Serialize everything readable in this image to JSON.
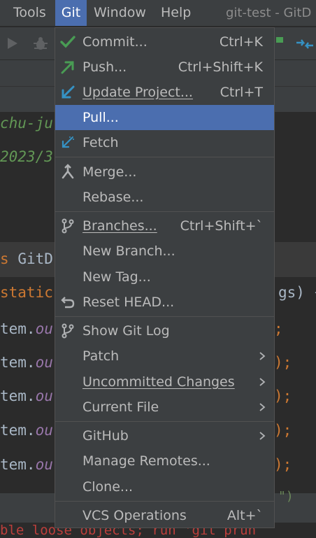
{
  "menubar": {
    "items": [
      {
        "label": "Tools",
        "mnemonic": "T"
      },
      {
        "label": "Git",
        "mnemonic": "G"
      },
      {
        "label": "Window",
        "mnemonic": "W"
      },
      {
        "label": "Help",
        "mnemonic": "H"
      }
    ],
    "window_title": "git-test - GitD"
  },
  "editor": {
    "line_author": "chu-ju",
    "line_date": "2023/3",
    "class_kw": "s",
    "class_name": "GitD",
    "static_kw": "static",
    "args_tail": "gs) {",
    "sys_prefix": "tem.",
    "sys_method": "ou",
    "tails": [
      ";",
      ");",
      ");",
      ");",
      ");"
    ],
    "bottom_tail": "\")",
    "red_text": "ble loose objects; run 'git prun"
  },
  "menu": {
    "items": [
      {
        "label": "Commit...",
        "shortcut": "Ctrl+K",
        "icon": "checkmark-icon"
      },
      {
        "label": "Push...",
        "shortcut": "Ctrl+Shift+K",
        "icon": "push-arrow-icon"
      },
      {
        "label": "Update Project...",
        "shortcut": "Ctrl+T",
        "icon": "update-arrow-icon"
      },
      {
        "label": "Pull...",
        "shortcut": "",
        "icon": "",
        "highlighted": true
      },
      {
        "label": "Fetch",
        "shortcut": "",
        "icon": "fetch-icon"
      },
      {
        "label": "Merge...",
        "shortcut": "",
        "icon": "merge-icon"
      },
      {
        "label": "Rebase...",
        "shortcut": "",
        "icon": ""
      },
      {
        "label": "Branches...",
        "shortcut": "Ctrl+Shift+`",
        "icon": "branch-icon"
      },
      {
        "label": "New Branch...",
        "shortcut": "",
        "icon": ""
      },
      {
        "label": "New Tag...",
        "shortcut": "",
        "icon": ""
      },
      {
        "label": "Reset HEAD...",
        "shortcut": "",
        "icon": "reset-icon"
      },
      {
        "label": "Show Git Log",
        "shortcut": "",
        "icon": "git-log-icon"
      },
      {
        "label": "Patch",
        "shortcut": "",
        "submenu": true
      },
      {
        "label": "Uncommitted Changes",
        "shortcut": "",
        "submenu": true
      },
      {
        "label": "Current File",
        "shortcut": "",
        "submenu": true
      },
      {
        "label": "GitHub",
        "shortcut": "",
        "submenu": true
      },
      {
        "label": "Manage Remotes...",
        "shortcut": ""
      },
      {
        "label": "Clone...",
        "shortcut": ""
      },
      {
        "label": "VCS Operations",
        "shortcut": "Alt+`"
      }
    ]
  },
  "colors": {
    "highlight": "#4b6eaf",
    "menu_bg": "#3c3f41",
    "editor_bg": "#2b2b2b",
    "check_green": "#499c54",
    "arrow_blue": "#3592c4"
  }
}
